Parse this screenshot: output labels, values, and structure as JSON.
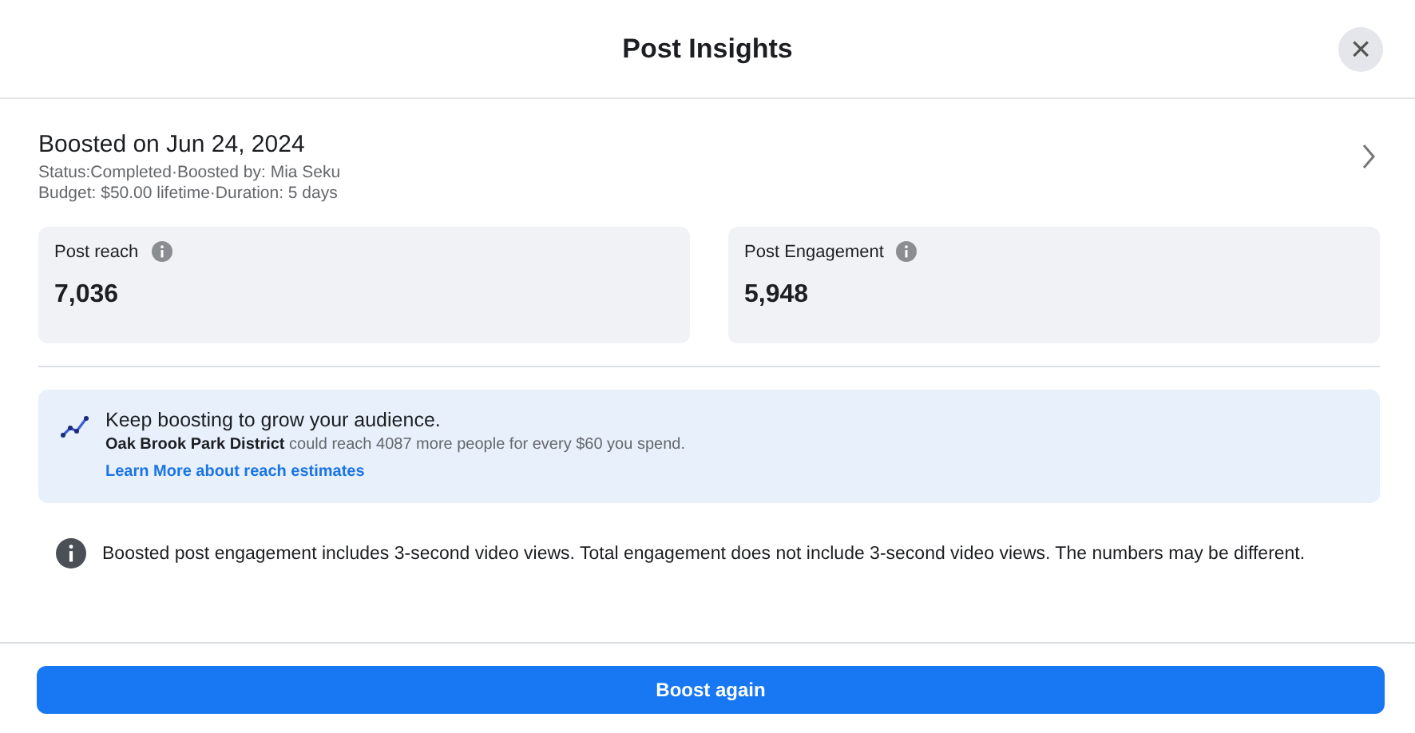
{
  "dialog": {
    "title": "Post Insights",
    "close": "×"
  },
  "boost": {
    "title": "Boosted on Jun 24, 2024",
    "status_line": "Status:Completed·Boosted by: Mia Seku",
    "budget_line": "Budget: $50.00 lifetime·Duration: 5 days"
  },
  "stats": [
    {
      "label": "Post reach",
      "value": "7,036"
    },
    {
      "label": "Post Engagement",
      "value": "5,948"
    }
  ],
  "tip": {
    "title": "Keep boosting to grow your audience.",
    "text": "**Oak Brook Park District** could reach 4087 more people for every $60 you spend.",
    "link": "Learn More about reach estimates"
  },
  "note": "Boosted post engagement includes 3-second video views. Total engagement does not include 3-second video views. The numbers may be different.",
  "button": "Boost again"
}
